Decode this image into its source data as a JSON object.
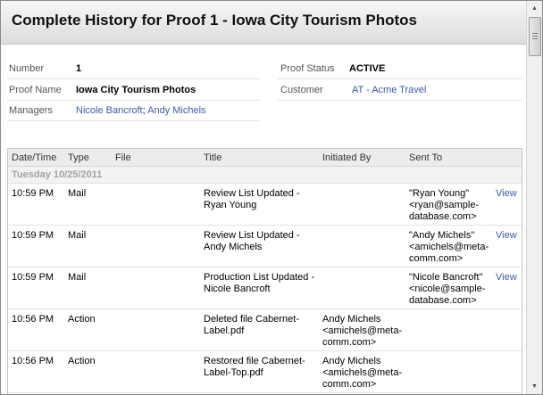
{
  "window": {
    "title": "Complete History for Proof 1 - Iowa City Tourism Photos"
  },
  "details": {
    "number_label": "Number",
    "number": "1",
    "proof_name_label": "Proof Name",
    "proof_name": "Iowa City Tourism Photos",
    "managers_label": "Managers",
    "manager_1": "Nicole Bancroft",
    "manager_sep": ";",
    "manager_2": "Andy Michels",
    "status_label": "Proof Status",
    "status": "ACTIVE",
    "customer_label": "Customer",
    "customer": "AT - Acme Travel"
  },
  "history": {
    "columns": [
      "Date/Time",
      "Type",
      "File",
      "Title",
      "Initiated By",
      "Sent To"
    ],
    "group_label": "Tuesday 10/25/2011",
    "rows": [
      {
        "time": "10:59 PM",
        "type": "Mail",
        "file": "",
        "title": "Review List Updated -\nRyan Young",
        "initiated_by": "",
        "sent_to": "\"Ryan Young\"\n<ryan@sample-\ndatabase.com>",
        "action": "View"
      },
      {
        "time": "10:59 PM",
        "type": "Mail",
        "file": "",
        "title": "Review List Updated -\nAndy Michels",
        "initiated_by": "",
        "sent_to": "\"Andy Michels\"\n<amichels@meta-\ncomm.com>",
        "action": "View"
      },
      {
        "time": "10:59 PM",
        "type": "Mail",
        "file": "",
        "title": "Production List Updated -\nNicole Bancroft",
        "initiated_by": "",
        "sent_to": "\"Nicole Bancroft\"\n<nicole@sample-\ndatabase.com>",
        "action": "View"
      },
      {
        "time": "10:56 PM",
        "type": "Action",
        "file": "",
        "title": "Deleted file Cabernet-\nLabel.pdf",
        "initiated_by": "Andy Michels\n<amichels@meta-\ncomm.com>",
        "sent_to": "",
        "action": ""
      },
      {
        "time": "10:56 PM",
        "type": "Action",
        "file": "",
        "title": "Restored file Cabernet-\nLabel-Top.pdf",
        "initiated_by": "Andy Michels\n<amichels@meta-\ncomm.com>",
        "sent_to": "",
        "action": ""
      }
    ]
  },
  "scrollbar": {
    "up_icon": "arrow-up-icon",
    "down_icon": "arrow-down-icon"
  }
}
